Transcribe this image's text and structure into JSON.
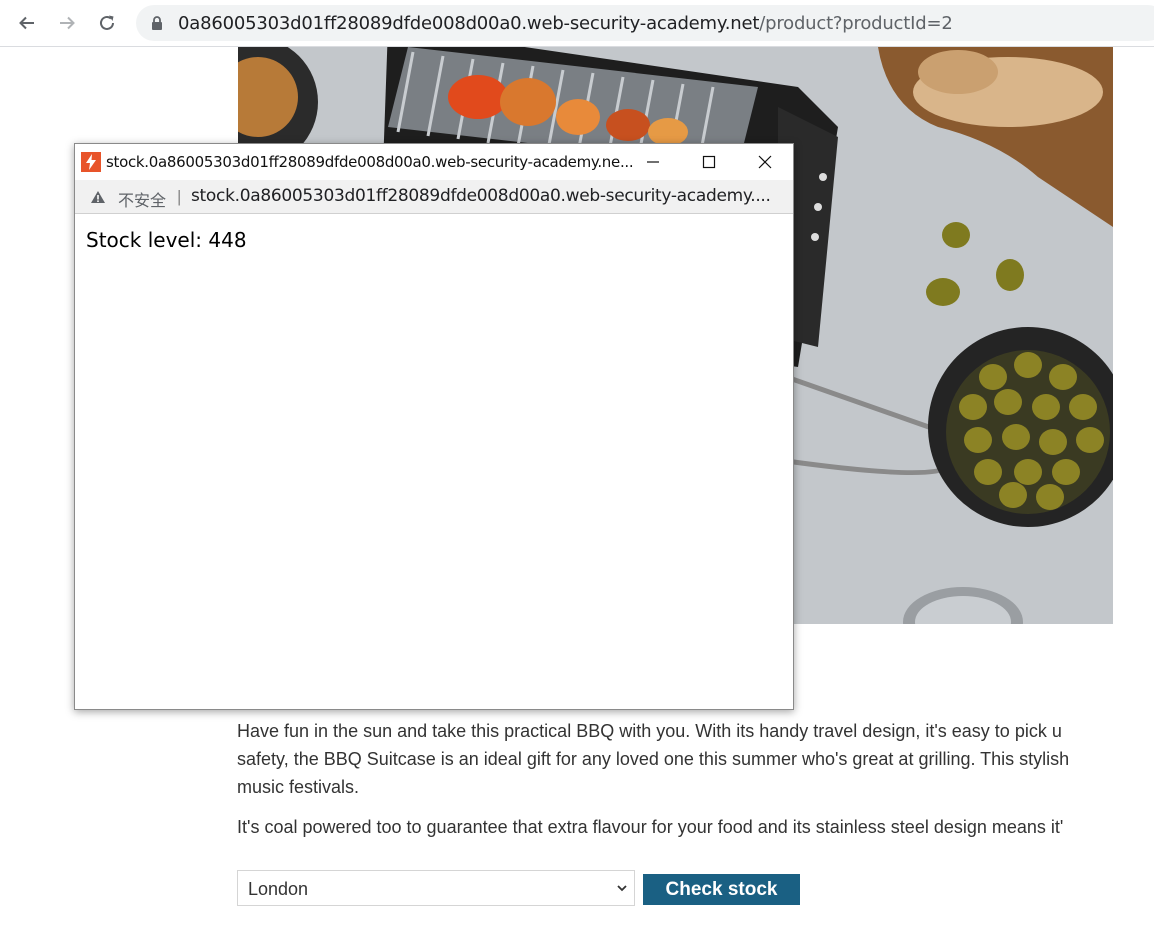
{
  "browser": {
    "url_host": "0a86005303d01ff28089dfde008d00a0.web-security-academy.net",
    "url_path": "/product?productId=2"
  },
  "product": {
    "description_1": "Have fun in the sun and take this practical BBQ with you. With its handy travel design, it's easy to pick u",
    "description_1b": "safety, the BBQ Suitcase is an ideal gift for any loved one this summer who's great at grilling. This stylish",
    "description_1c": "music festivals.",
    "description_2": "It's coal powered too to guarantee that extra flavour for your food and its stainless steel design means it'",
    "store_select_value": "London",
    "check_stock_label": "Check stock"
  },
  "popup": {
    "title": "stock.0a86005303d01ff28089dfde008d00a0.web-security-academy.ne...",
    "insecure_label": "不安全",
    "separator": "|",
    "url": "stock.0a86005303d01ff28089dfde008d00a0.web-security-academy....",
    "content": "Stock level: 448"
  },
  "colors": {
    "accent_button": "#1a6083",
    "favicon": "#e8542a"
  }
}
